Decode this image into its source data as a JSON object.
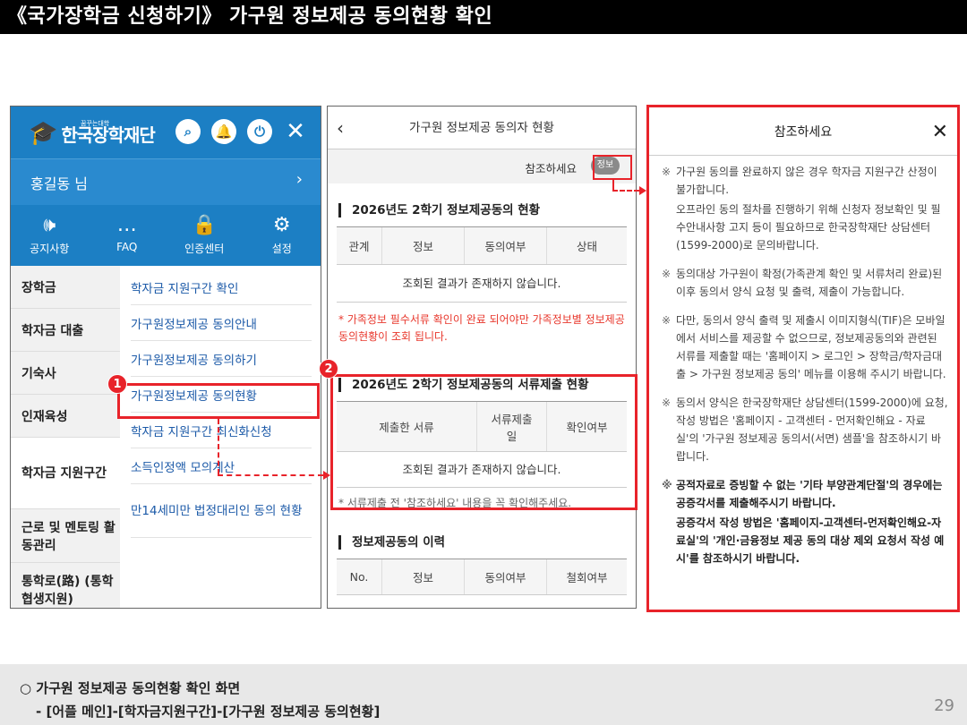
{
  "title": "《국가장학금 신청하기》 가구원 정보제공 동의현황 확인",
  "panel1": {
    "logo_small": "꿈꾸는대학",
    "logo_text": "한국장학재단",
    "user_name": "홍길동 님",
    "quick": [
      {
        "icon": "speaker-icon",
        "glyph": "🕪",
        "label": "공지사항"
      },
      {
        "icon": "chat-icon",
        "glyph": "…",
        "label": "FAQ"
      },
      {
        "icon": "lock-icon",
        "glyph": "🔒",
        "label": "인증센터"
      },
      {
        "icon": "gear-icon",
        "glyph": "⚙",
        "label": "설정"
      }
    ],
    "left_menu": [
      "장학금",
      "학자금 대출",
      "기숙사",
      "인재육성",
      "학자금 지원구간",
      "근로 및 멘토링 활동관리",
      "통학로(路) (통학 협생지원)"
    ],
    "right_menu": [
      "학자금 지원구간 확인",
      "가구원정보제공 동의안내",
      "가구원정보제공 동의하기",
      "가구원정보제공 동의현황",
      "학자금 지원구간 최신화신청",
      "소득인정액 모의계산",
      "만14세미만 법정대리인 동의 현황"
    ]
  },
  "panel2": {
    "header": "가구원 정보제공 동의자 현황",
    "ref_text": "참조하세요",
    "badge": "정보",
    "section1_title": "2026년도 2학기 정보제공동의 현황",
    "table1_headers": [
      "관계",
      "정보",
      "동의여부",
      "상태"
    ],
    "empty_text": "조회된 결과가 존재하지 않습니다.",
    "warning": "* 가족정보 필수서류 확인이 완료 되어야만 가족정보별 정보제공 동의현황이 조회 됩니다.",
    "section2_title": "2026년도 2학기 정보제공동의 서류제출 현황",
    "table2_headers": [
      "제출한 서류",
      "서류제출일",
      "확인여부"
    ],
    "note": "* 서류제출 전 '참조하세요' 내용을 꼭 확인해주세요.",
    "section3_title": "정보제공동의 이력",
    "table3_headers": [
      "No.",
      "정보",
      "동의여부",
      "철회여부"
    ]
  },
  "panel3": {
    "header": "참조하세요",
    "items": [
      {
        "mark": "※",
        "text": "가구원 동의를 완료하지 않은 경우 학자금 지원구간 산정이 불가합니다."
      },
      {
        "mark": "",
        "text": "오프라인 동의 절차를 진행하기 위해 신청자 정보확인 및 필수안내사항 고지 등이 필요하므로 한국장학재단 상담센터(1599-2000)로 문의바랍니다."
      },
      {
        "mark": "※",
        "text": "동의대상 가구원이 확정(가족관계 확인 및 서류처리 완료)된 이후 동의서 양식 요청 및 출력, 제출이 가능합니다."
      },
      {
        "mark": "※",
        "text": "다만, 동의서 양식 출력 및 제출시 이미지형식(TIF)은 모바일에서 서비스를 제공할 수 없으므로, 정보제공동의와 관련된 서류를 제출할 때는 '홈페이지 > 로그인 > 장학금/학자금대출 > 가구원 정보제공 동의' 메뉴를 이용해 주시기 바랍니다."
      },
      {
        "mark": "※",
        "text": "동의서 양식은 한국장학재단 상담센터(1599-2000)에 요청, 작성 방법은 '홈페이지 - 고객센터 - 먼저확인해요 - 자료실'의 '가구원 정보제공 동의서(서면) 샘플'을 참조하시기 바랍니다."
      },
      {
        "mark": "※",
        "text": "공적자료로 증빙할 수 없는 '기타 부양관계단절'의 경우에는 공증각서를 제출해주시기 바랍니다."
      },
      {
        "mark": "",
        "text": "공증각서 작성 방법은 '홈페이지-고객센터-먼저확인해요-자료실'의 '개인·금융정보 제공 동의 대상 제외 요청서 작성 예시'를 참조하시기 바랍니다."
      }
    ]
  },
  "annotations": {
    "num1": "1",
    "num2": "2"
  },
  "footer": {
    "line1": "○ 가구원 정보제공 동의현황 확인 화면",
    "line2": "- [어플 메인]-[학자금지원구간]-[가구원 정보제공 동의현황]",
    "page": "29"
  },
  "colors": {
    "accent_red": "#e8232a",
    "brand_blue": "#1c7fc4",
    "link_blue": "#1c5aa8"
  }
}
